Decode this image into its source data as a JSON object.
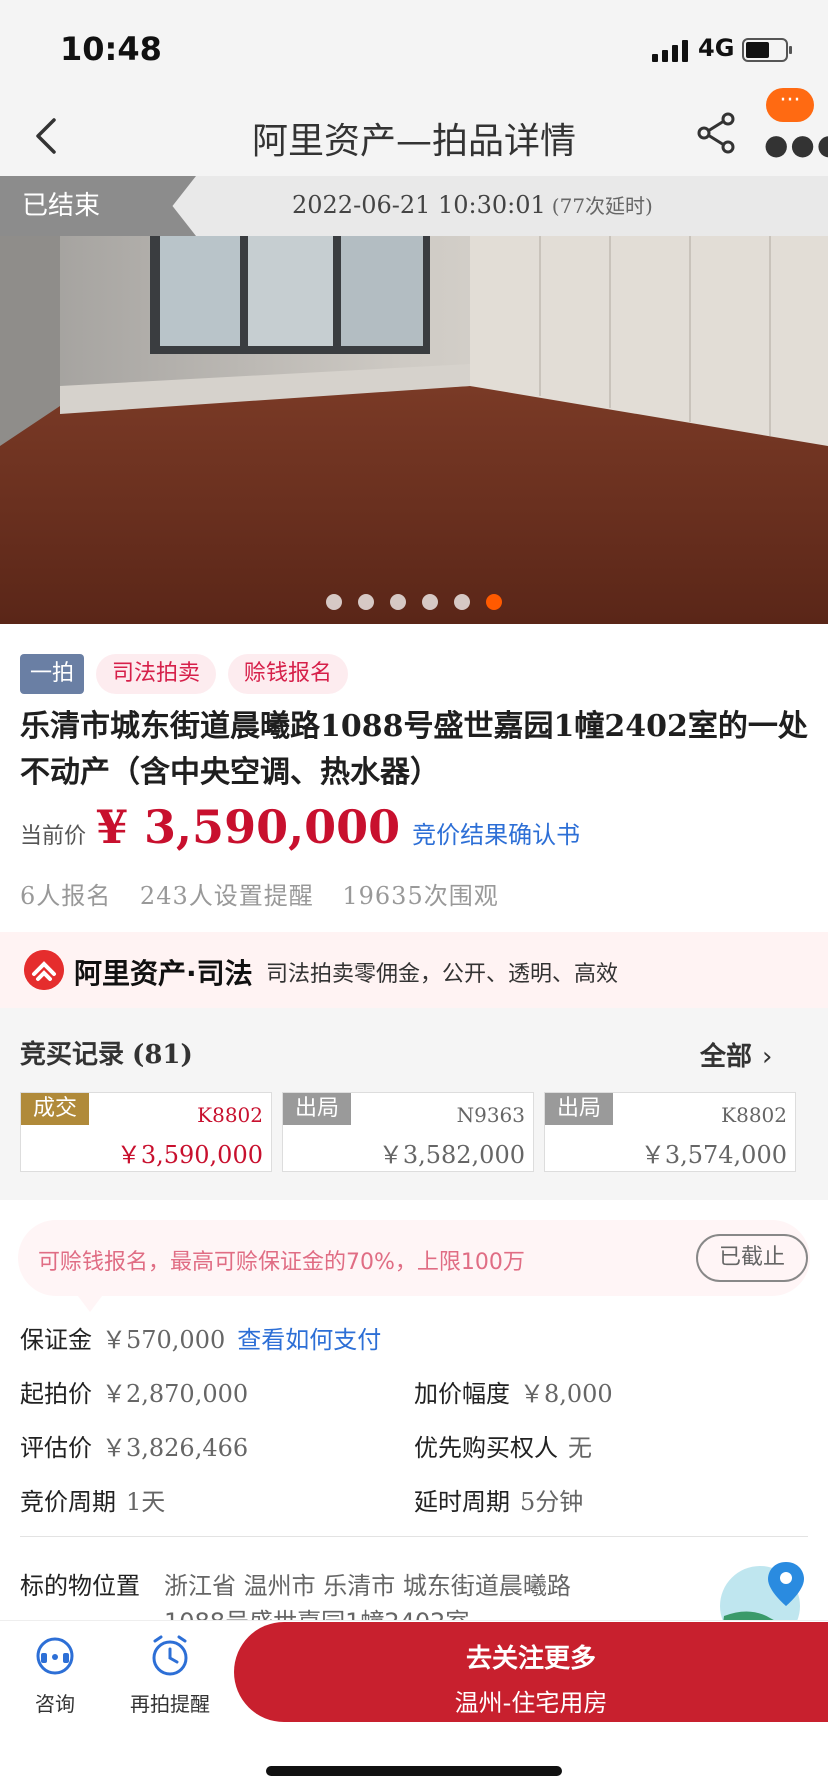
{
  "status_bar": {
    "time": "10:48",
    "network": "4G",
    "battery_level": 0.6
  },
  "nav": {
    "title": "阿里资产—拍品详情",
    "icons": [
      "back-icon",
      "share-icon",
      "more-icon",
      "message-badge-icon"
    ],
    "message_badge": "···"
  },
  "auction": {
    "status": "已结束",
    "end_time": "2022-06-21 10:30:01",
    "delays": "(77次延时)"
  },
  "gallery": {
    "count": 6,
    "active_index": 5
  },
  "tags": [
    "一拍",
    "司法拍卖",
    "赊钱报名"
  ],
  "item": {
    "title": "乐清市城东街道晨曦路1088号盛世嘉园1幢2402室的一处不动产（含中央空调、热水器）",
    "price_label": "当前价",
    "price": "¥ 3,590,000",
    "confirm_link": "竞价结果确认书",
    "stats": [
      "6人报名",
      "243人设置提醒",
      "19635次围观"
    ]
  },
  "banner": {
    "brand": "阿里资产·司法",
    "slogan": "司法拍卖零佣金，公开、透明、高效"
  },
  "bids": {
    "title": "竞买记录",
    "count": "(81)",
    "all_label": "全部",
    "records": [
      {
        "badge": "成交",
        "user": "K8802",
        "amount": "￥3,590,000"
      },
      {
        "badge": "出局",
        "user": "N9363",
        "amount": "￥3,582,000"
      },
      {
        "badge": "出局",
        "user": "K8802",
        "amount": "￥3,574,000"
      }
    ]
  },
  "deposit_note": {
    "text": "可赊钱报名，最高可赊保证金的70%，上限100万",
    "button": "已截止"
  },
  "details": {
    "deposit": {
      "label": "保证金",
      "value": "￥570,000",
      "link": "查看如何支付"
    },
    "start_price": {
      "label": "起拍价",
      "value": "￥2,870,000"
    },
    "increment": {
      "label": "加价幅度",
      "value": "￥8,000"
    },
    "appraisal": {
      "label": "评估价",
      "value": "￥3,826,466"
    },
    "priority_buyer": {
      "label": "优先购买权人",
      "value": "无"
    },
    "bid_period": {
      "label": "竞价周期",
      "value": "1天"
    },
    "delay_period": {
      "label": "延时周期",
      "value": "5分钟"
    },
    "location": {
      "label": "标的物位置",
      "value": "浙江省 温州市 乐清市 城东街道晨曦路1088号盛世嘉园1幢2402室"
    }
  },
  "bottom_bar": {
    "consult": "咨询",
    "remind": "再拍提醒",
    "follow_line1": "去关注更多",
    "follow_line2": "温州-住宅用房"
  },
  "colors": {
    "accent": "#c8202e",
    "link": "#2d6fd6",
    "status_gray": "#8c8c8c",
    "win_badge": "#b08a3a"
  }
}
